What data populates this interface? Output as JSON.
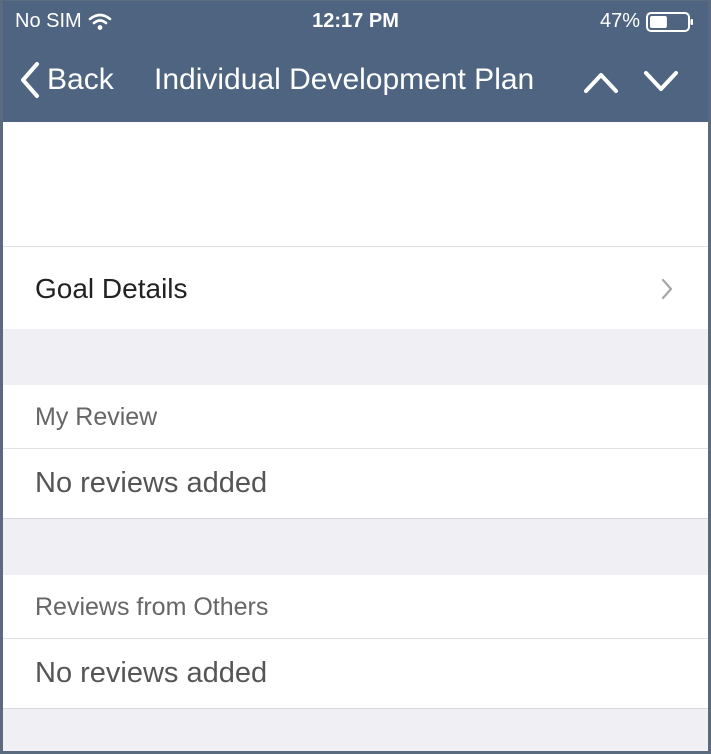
{
  "status_bar": {
    "carrier": "No SIM",
    "time": "12:17 PM",
    "battery_percent": "47%",
    "battery_level": 0.47,
    "wifi_icon": "wifi-icon",
    "battery_icon": "battery-icon"
  },
  "nav_bar": {
    "back_label": "Back",
    "title": "Individual Development Plan",
    "back_icon": "chevron-left-icon",
    "up_icon": "chevron-up-icon",
    "down_icon": "chevron-down-icon"
  },
  "goal_details": {
    "label": "Goal Details",
    "icon": "chevron-right-icon"
  },
  "my_review": {
    "header": "My Review",
    "empty_text": "No reviews added"
  },
  "reviews_from_others": {
    "header": "Reviews from Others",
    "empty_text": "No reviews added"
  },
  "colors": {
    "header_background": "#4e6480",
    "group_background": "#efeff4",
    "separator": "#e1e1e6"
  }
}
